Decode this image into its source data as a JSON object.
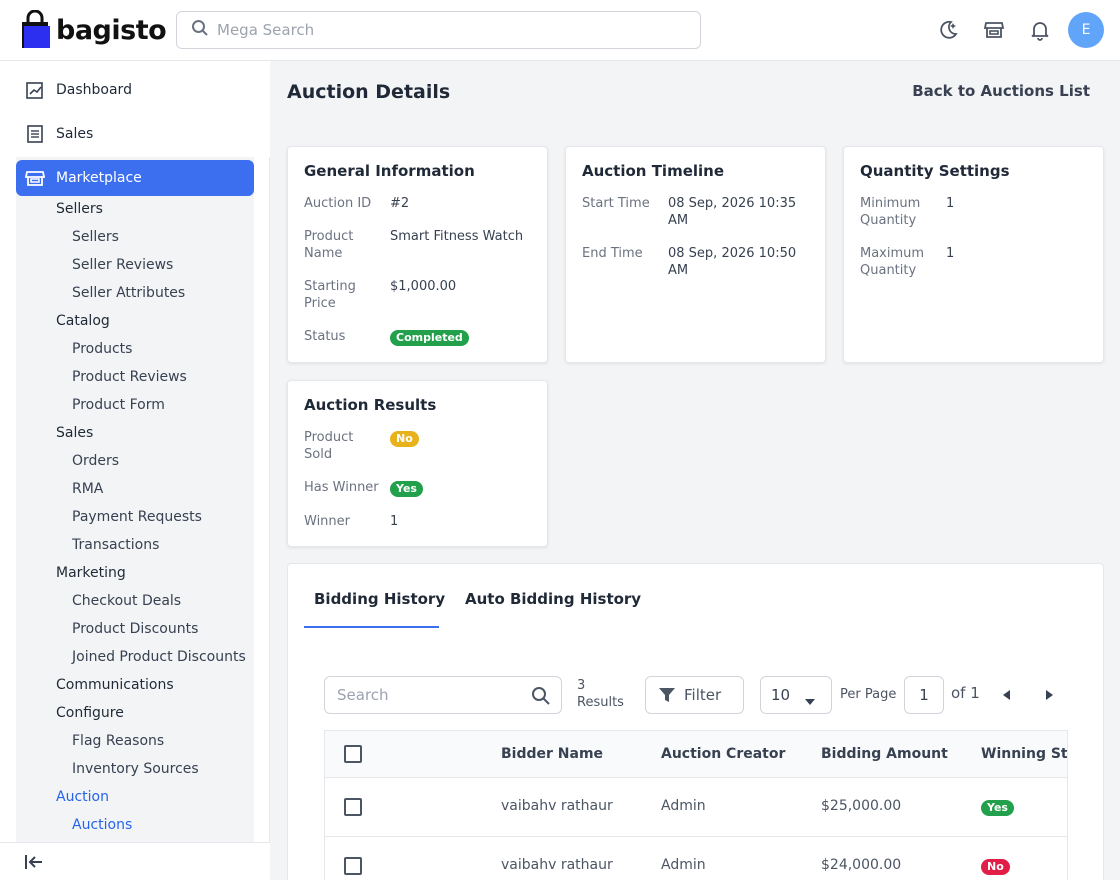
{
  "header": {
    "logo_text": "bagisto",
    "search_placeholder": "Mega Search",
    "avatar_initial": "E"
  },
  "sidebar": {
    "dashboard": "Dashboard",
    "sales": "Sales",
    "marketplace": "Marketplace",
    "sellers_group": "Sellers",
    "sellers": "Sellers",
    "seller_reviews": "Seller Reviews",
    "seller_attributes": "Seller Attributes",
    "catalog_group": "Catalog",
    "products": "Products",
    "product_reviews": "Product Reviews",
    "product_form": "Product Form",
    "sales_group": "Sales",
    "orders": "Orders",
    "rma": "RMA",
    "payment_requests": "Payment Requests",
    "transactions": "Transactions",
    "marketing_group": "Marketing",
    "checkout_deals": "Checkout Deals",
    "product_discounts": "Product Discounts",
    "joined_product_discounts": "Joined Product Discounts",
    "communications": "Communications",
    "configure_group": "Configure",
    "flag_reasons": "Flag Reasons",
    "inventory_sources": "Inventory Sources",
    "auction_group": "Auction",
    "auctions": "Auctions"
  },
  "page": {
    "title": "Auction Details",
    "back_link": "Back to Auctions List"
  },
  "general": {
    "title": "General Information",
    "auction_id_label": "Auction ID",
    "auction_id": "#2",
    "product_name_label": "Product Name",
    "product_name": "Smart Fitness Watch",
    "starting_price_label": "Starting Price",
    "starting_price": "$1,000.00",
    "status_label": "Status",
    "status": "Completed"
  },
  "timeline": {
    "title": "Auction Timeline",
    "start_label": "Start Time",
    "start": "08 Sep, 2026 10:35 AM",
    "end_label": "End Time",
    "end": "08 Sep, 2026 10:50 AM"
  },
  "quantity": {
    "title": "Quantity Settings",
    "min_label": "Minimum Quantity",
    "min": "1",
    "max_label": "Maximum Quantity",
    "max": "1"
  },
  "results": {
    "title": "Auction Results",
    "sold_label": "Product Sold",
    "sold": "No",
    "winner_flag_label": "Has Winner",
    "winner_flag": "Yes",
    "winner_label": "Winner",
    "winner": "1"
  },
  "tabs": {
    "bidding": "Bidding History",
    "auto_bidding": "Auto Bidding History"
  },
  "grid": {
    "search_placeholder": "Search",
    "results_count": "3",
    "results_label": "Results",
    "filter_label": "Filter",
    "per_page_value": "10",
    "per_page_label": "Per Page",
    "current_page": "1",
    "of_label": "of 1",
    "columns": [
      "Bidder Name",
      "Auction Creator",
      "Bidding Amount",
      "Winning Status"
    ],
    "rows": [
      {
        "bidder": "vaibahv rathaur",
        "creator": "Admin",
        "amount": "$25,000.00",
        "status": "Yes"
      },
      {
        "bidder": "vaibahv rathaur",
        "creator": "Admin",
        "amount": "$24,000.00",
        "status": "No"
      }
    ]
  },
  "colors": {
    "accent": "#3b6ff0",
    "success": "#22a04b",
    "warning": "#e8b21c",
    "danger": "#e11d48"
  }
}
